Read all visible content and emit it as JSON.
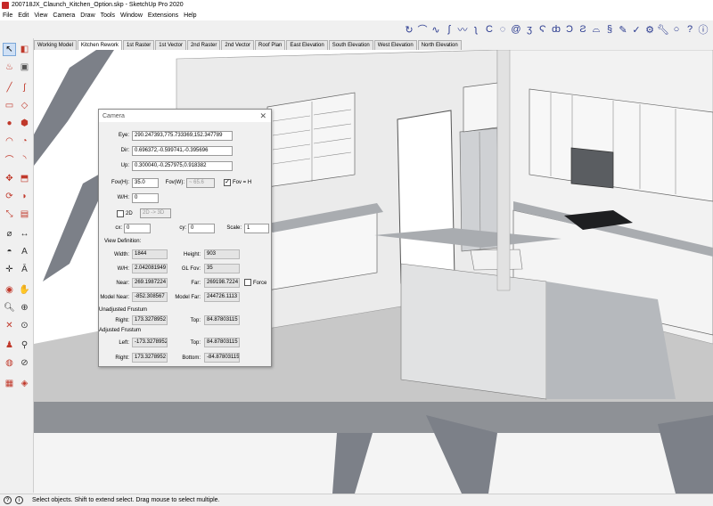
{
  "window": {
    "title": "200718JX_Claunch_Kitchen_Option.skp - SketchUp Pro 2020"
  },
  "menu": [
    "File",
    "Edit",
    "View",
    "Camera",
    "Draw",
    "Tools",
    "Window",
    "Extensions",
    "Help"
  ],
  "scenes": [
    "Working Model",
    "Kitchen Rework",
    "1st Raster",
    "1st Vector",
    "2nd Raster",
    "2nd Vector",
    "Roof Plan",
    "East Elevation",
    "South Elevation",
    "West Elevation",
    "North Elevation"
  ],
  "active_scene": "Kitchen Rework",
  "camera_dialog": {
    "title": "Camera",
    "eye_label": "Eye:",
    "eye": "290.247393,775.733369,152.347789",
    "dir_label": "Dir:",
    "dir": "0.696372,-0.599741,-0.395696",
    "up_label": "Up:",
    "up": "0.300040,-0.257975,0.918382",
    "fovh_label": "Fov(H):",
    "fovh": "35.0",
    "fovw_label": "Fov(W):",
    "fovw": "~ 65.6",
    "fov_h_check_label": "Fov = H",
    "wh_label": "W/H:",
    "wh": "0",
    "twod_label": "2D",
    "twod_range": "2D -> 3D",
    "cx_label": "cx:",
    "cx": "0",
    "cy_label": "cy:",
    "cy": "0",
    "scale_label": "Scale:",
    "scale": "1",
    "view_def_label": "View Definition:",
    "width_label": "Width:",
    "width": "1844",
    "height_label": "Height:",
    "height": "903",
    "wh2_label": "W/H:",
    "wh2": "2.042081949",
    "glfov_label": "GL Fov:",
    "glfov": "35",
    "near_label": "Near:",
    "near": "269.1987224",
    "far_label": "Far:",
    "far": "269198.7224",
    "force_label": "Force",
    "model_near_label": "Model Near:",
    "model_near": "-852.308567",
    "model_far_label": "Model Far:",
    "model_far": "244726.1113",
    "unadjusted_label": "Unadjusted Frustum",
    "ua_right_label": "Right:",
    "ua_right": "173.3278952",
    "ua_top_label": "Top:",
    "ua_top": "84.87803115",
    "adjusted_label": "Adjusted Frustum",
    "a_left_label": "Left:",
    "a_left": "-173.3278952",
    "a_top_label": "Top:",
    "a_top": "84.87803115",
    "a_right_label": "Right:",
    "a_right": "173.3278952",
    "a_bottom_label": "Bottom:",
    "a_bottom": "-84.87803115"
  },
  "status": {
    "text": "Select objects. Shift to extend select. Drag mouse to select multiple."
  }
}
